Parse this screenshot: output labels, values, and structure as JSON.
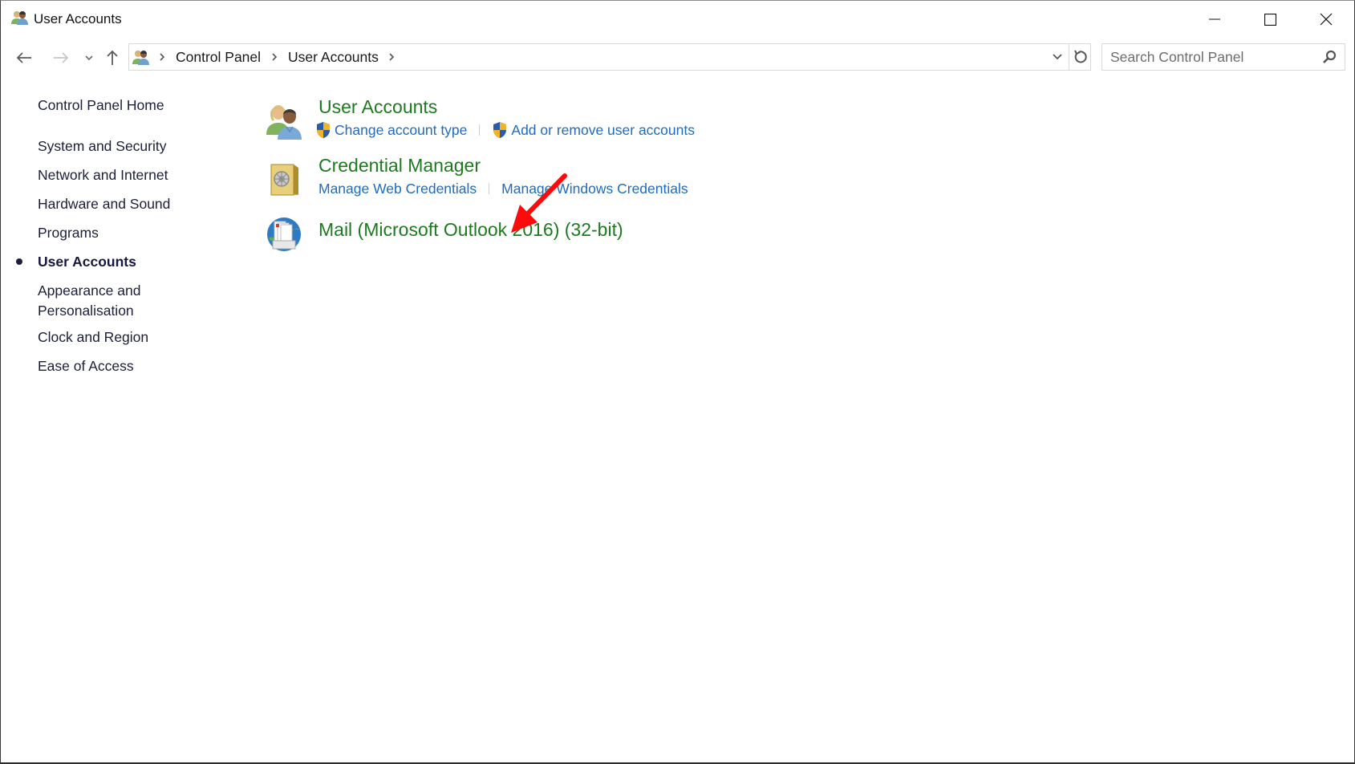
{
  "window": {
    "title": "User Accounts",
    "title_icon": "user-accounts-icon",
    "controls": {
      "minimize": "minimize-icon",
      "maximize": "maximize-icon",
      "close": "close-icon"
    }
  },
  "navigation": {
    "back": "back-arrow-icon",
    "forward": "forward-arrow-icon",
    "recent": "chevron-down-icon",
    "up": "up-arrow-icon"
  },
  "address_bar": {
    "icon": "user-accounts-icon",
    "breadcrumbs": [
      "Control Panel",
      "User Accounts"
    ],
    "dropdown_icon": "chevron-down-icon",
    "refresh_icon": "refresh-icon"
  },
  "search": {
    "placeholder": "Search Control Panel",
    "value": "",
    "icon": "search-icon"
  },
  "sidebar": {
    "home": "Control Panel Home",
    "items": [
      {
        "label": "System and Security",
        "active": false
      },
      {
        "label": "Network and Internet",
        "active": false
      },
      {
        "label": "Hardware and Sound",
        "active": false
      },
      {
        "label": "Programs",
        "active": false
      },
      {
        "label": "User Accounts",
        "active": true
      },
      {
        "label": "Appearance and Personalisation",
        "label_line1": "Appearance and",
        "label_line2": "Personalisation",
        "active": false
      },
      {
        "label": "Clock and Region",
        "active": false
      },
      {
        "label": "Ease of Access",
        "active": false
      }
    ]
  },
  "main": {
    "categories": [
      {
        "title": "User Accounts",
        "icon": "users-icon",
        "links": [
          {
            "label": "Change account type",
            "icon": "uac-shield-icon"
          },
          {
            "label": "Add or remove user accounts",
            "icon": "uac-shield-icon"
          }
        ]
      },
      {
        "title": "Credential Manager",
        "icon": "vault-icon",
        "links": [
          {
            "label": "Manage Web Credentials"
          },
          {
            "label": "Manage Windows Credentials"
          }
        ]
      },
      {
        "title": "Mail (Microsoft Outlook 2016) (32-bit)",
        "icon": "mail-icon",
        "links": []
      }
    ]
  },
  "annotation": {
    "type": "red-arrow",
    "points_to": "Mail (Microsoft Outlook 2016) (32-bit)",
    "color": "#ff0000"
  },
  "colors": {
    "heading_green": "#1e7a1e",
    "link_blue": "#1e6bbf",
    "sidebar_text": "#1b1f3b"
  }
}
